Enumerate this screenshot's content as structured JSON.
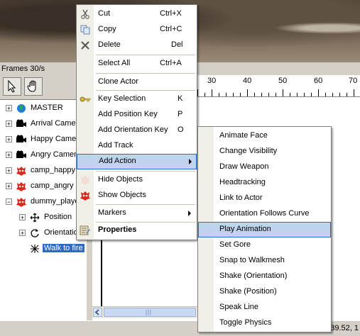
{
  "header": {
    "frames_label": "Frames 30/s"
  },
  "ruler": {
    "ticks": [
      "30",
      "40",
      "50",
      "60",
      "70"
    ]
  },
  "tree": {
    "items": [
      {
        "label": "MASTER",
        "icon": "globe-icon"
      },
      {
        "label": "Arrival Camer",
        "icon": "camera-icon"
      },
      {
        "label": "Happy Camer",
        "icon": "camera-icon"
      },
      {
        "label": "Angry Camer",
        "icon": "camera-icon"
      },
      {
        "label": "camp_happy",
        "icon": "actor-icon"
      },
      {
        "label": "camp_angry",
        "icon": "actor-icon"
      },
      {
        "label": "dummy_playe",
        "icon": "actor-icon"
      },
      {
        "label": "Position",
        "icon": "move-icon"
      },
      {
        "label": "Orientation",
        "icon": "rotate-icon"
      },
      {
        "label": "Walk to fire",
        "icon": "action-icon"
      }
    ]
  },
  "context_menu": {
    "items": [
      {
        "label": "Cut",
        "shortcut": "Ctrl+X"
      },
      {
        "label": "Copy",
        "shortcut": "Ctrl+C"
      },
      {
        "label": "Delete",
        "shortcut": "Del"
      },
      {
        "label": "Select All",
        "shortcut": "Ctrl+A"
      },
      {
        "label": "Clone Actor",
        "shortcut": ""
      },
      {
        "label": "Key Selection",
        "shortcut": "K"
      },
      {
        "label": "Add Position Key",
        "shortcut": "P"
      },
      {
        "label": "Add Orientation Key",
        "shortcut": "O"
      },
      {
        "label": "Add Track",
        "shortcut": ""
      },
      {
        "label": "Add Action",
        "shortcut": ""
      },
      {
        "label": "Hide Objects",
        "shortcut": ""
      },
      {
        "label": "Show Objects",
        "shortcut": ""
      },
      {
        "label": "Markers",
        "shortcut": ""
      },
      {
        "label": "Properties",
        "shortcut": ""
      }
    ]
  },
  "submenu": {
    "items": [
      "Animate Face",
      "Change Visibility",
      "Draw Weapon",
      "Headtracking",
      "Link to Actor",
      "Orientation Follows Curve",
      "Play Animation",
      "Set Gore",
      "Snap to Walkmesh",
      "Shake (Orientation)",
      "Shake (Position)",
      "Speak Line",
      "Toggle Physics"
    ]
  },
  "status": {
    "text": "39.52, 1"
  }
}
